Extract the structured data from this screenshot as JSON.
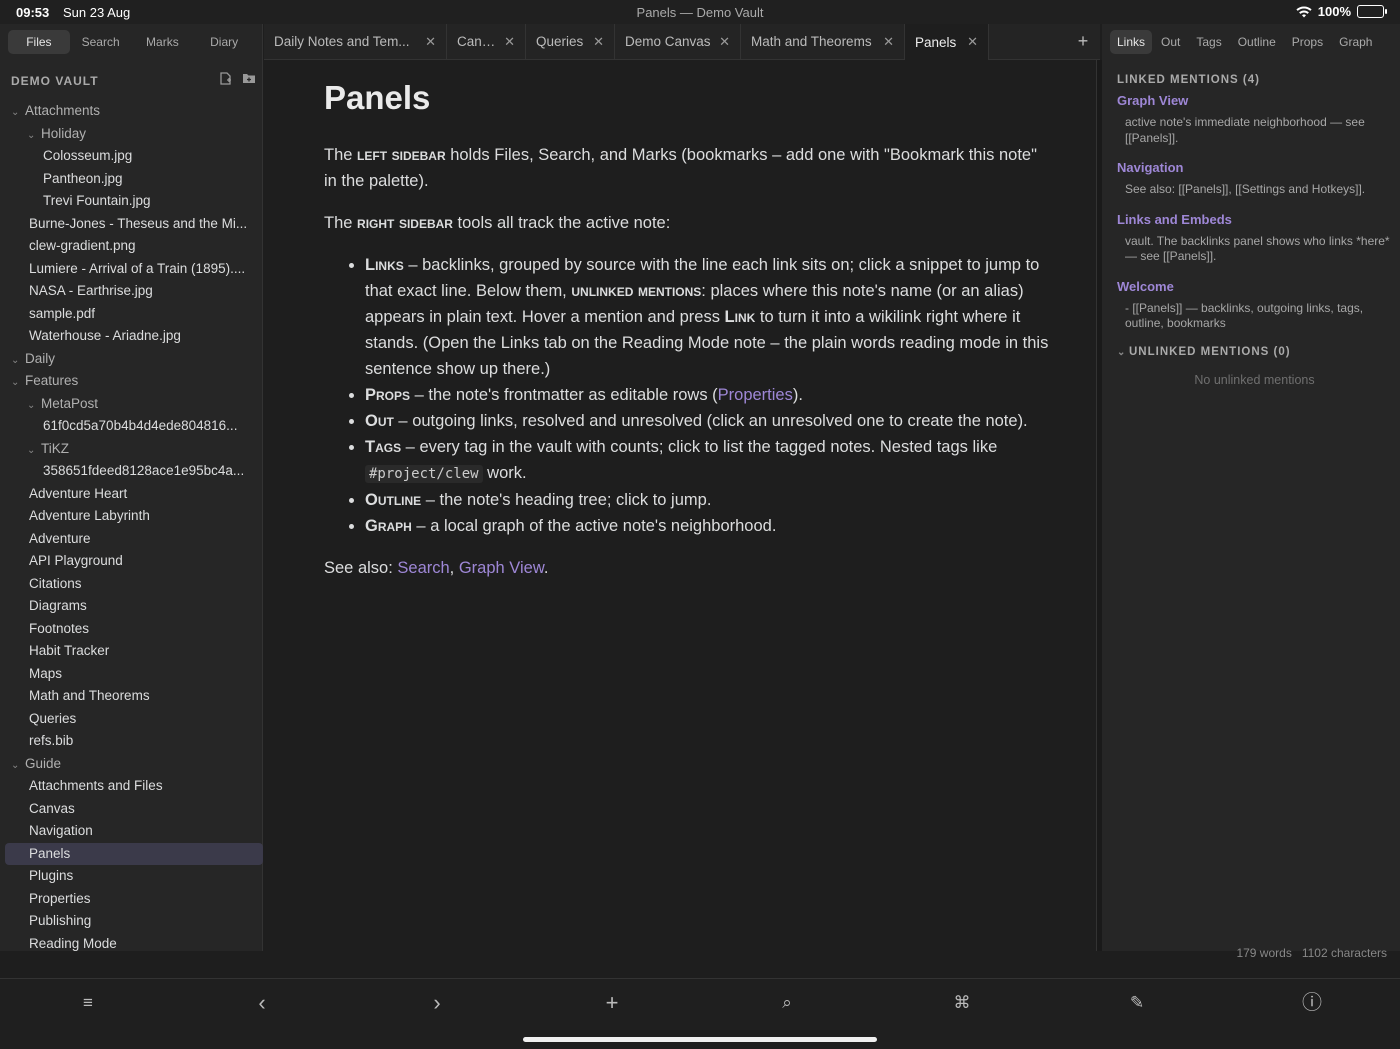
{
  "status": {
    "time": "09:53",
    "date": "Sun 23 Aug",
    "window_title": "Panels — Demo Vault",
    "battery": "100%",
    "battery_level": 1.0
  },
  "left_tabs": [
    {
      "label": "Files",
      "active": true
    },
    {
      "label": "Search",
      "active": false
    },
    {
      "label": "Marks",
      "active": false
    },
    {
      "label": "Diary",
      "active": false
    }
  ],
  "vault": {
    "name": "DEMO VAULT",
    "icon_new_note": "new-note-icon",
    "icon_new_folder": "new-folder-icon"
  },
  "file_tree": [
    {
      "label": "Attachments",
      "folder": true,
      "level": 0
    },
    {
      "label": "Holiday",
      "folder": true,
      "level": 1
    },
    {
      "label": "Colosseum.jpg",
      "level": 2
    },
    {
      "label": "Pantheon.jpg",
      "level": 2
    },
    {
      "label": "Trevi Fountain.jpg",
      "level": 2
    },
    {
      "label": "Burne-Jones - Theseus and the Mi...",
      "level": 1
    },
    {
      "label": "clew-gradient.png",
      "level": 1
    },
    {
      "label": "Lumiere - Arrival of a Train (1895)....",
      "level": 1
    },
    {
      "label": "NASA - Earthrise.jpg",
      "level": 1
    },
    {
      "label": "sample.pdf",
      "level": 1
    },
    {
      "label": "Waterhouse - Ariadne.jpg",
      "level": 1
    },
    {
      "label": "Daily",
      "folder": true,
      "level": 0
    },
    {
      "label": "Features",
      "folder": true,
      "level": 0
    },
    {
      "label": "MetaPost",
      "folder": true,
      "level": 1
    },
    {
      "label": "61f0cd5a70b4b4d4ede804816...",
      "level": 2
    },
    {
      "label": "TiKZ",
      "folder": true,
      "level": 1
    },
    {
      "label": "358651fdeed8128ace1e95bc4a...",
      "level": 2
    },
    {
      "label": "Adventure Heart",
      "level": 1
    },
    {
      "label": "Adventure Labyrinth",
      "level": 1
    },
    {
      "label": "Adventure",
      "level": 1
    },
    {
      "label": "API Playground",
      "level": 1
    },
    {
      "label": "Citations",
      "level": 1
    },
    {
      "label": "Diagrams",
      "level": 1
    },
    {
      "label": "Footnotes",
      "level": 1
    },
    {
      "label": "Habit Tracker",
      "level": 1
    },
    {
      "label": "Maps",
      "level": 1
    },
    {
      "label": "Math and Theorems",
      "level": 1
    },
    {
      "label": "Queries",
      "level": 1
    },
    {
      "label": "refs.bib",
      "level": 1
    },
    {
      "label": "Guide",
      "folder": true,
      "level": 0
    },
    {
      "label": "Attachments and Files",
      "level": 1
    },
    {
      "label": "Canvas",
      "level": 1
    },
    {
      "label": "Navigation",
      "level": 1
    },
    {
      "label": "Panels",
      "level": 1,
      "active": true
    },
    {
      "label": "Plugins",
      "level": 1
    },
    {
      "label": "Properties",
      "level": 1
    },
    {
      "label": "Publishing",
      "level": 1
    },
    {
      "label": "Reading Mode",
      "level": 1
    }
  ],
  "doc_tabs": [
    {
      "label": "Daily Notes and Tem...",
      "active": false
    },
    {
      "label": "Canvas",
      "active": false
    },
    {
      "label": "Queries",
      "active": false
    },
    {
      "label": "Demo Canvas",
      "active": false
    },
    {
      "label": "Math and Theorems",
      "active": false
    },
    {
      "label": "Panels",
      "active": true
    }
  ],
  "note": {
    "title": "Panels",
    "p1": {
      "a": "The ",
      "b": "left sidebar",
      "c": " holds Files, Search, and Marks (bookmarks – add one with \"Bookmark this note\" in the palette)."
    },
    "p2": {
      "a": "The ",
      "b": "right sidebar",
      "c": " tools all track the active note:"
    },
    "links_item": {
      "b1": "Links",
      "t1": " – backlinks, grouped by source with the line each link sits on; click a snippet to jump to that exact line. Below them, ",
      "b2": "unlinked mentions",
      "t2": ": places where this note's name (or an alias) appears in plain text. Hover a mention and press ",
      "b3": "Link",
      "t3": " to turn it into a wikilink right where it stands. (Open the Links tab on the Reading Mode note – the plain words reading mode in this sentence show up there.)"
    },
    "props_item": {
      "b": "Props",
      "t1": " – the note's frontmatter as editable rows (",
      "link": "Properties",
      "t2": ")."
    },
    "out_item": {
      "b": "Out",
      "t": " – outgoing links, resolved and unresolved (click an unresolved one to create the note)."
    },
    "tags_item": {
      "b": "Tags",
      "t1": " – every tag in the vault with counts; click to list the tagged notes. Nested tags like ",
      "code": "#project/clew",
      "t2": " work."
    },
    "outline_item": {
      "b": "Outline",
      "t": " – the note's heading tree; click to jump."
    },
    "graph_item": {
      "b": "Graph",
      "t": " – a local graph of the active note's neighborhood."
    },
    "see_also": {
      "prefix": "See also: ",
      "link1": "Search",
      "sep": ", ",
      "link2": "Graph View",
      "end": "."
    }
  },
  "right_tabs": [
    {
      "label": "Links",
      "active": true
    },
    {
      "label": "Out",
      "active": false
    },
    {
      "label": "Tags",
      "active": false
    },
    {
      "label": "Outline",
      "active": false
    },
    {
      "label": "Props",
      "active": false
    },
    {
      "label": "Graph",
      "active": false
    }
  ],
  "linked_mentions": {
    "heading": "LINKED MENTIONS (4)",
    "groups": [
      {
        "title": "Graph View",
        "snippet": "active note's immediate neighborhood — see [[Panels]]."
      },
      {
        "title": "Navigation",
        "snippet": "See also: [[Panels]], [[Settings and Hotkeys]]."
      },
      {
        "title": "Links and Embeds",
        "snippet": "vault. The backlinks panel shows who links *here* — see [[Panels]]."
      },
      {
        "title": "Welcome",
        "snippet": "- [[Panels]] — backlinks, outgoing links, tags, outline, bookmarks"
      }
    ]
  },
  "unlinked_mentions": {
    "heading": "UNLINKED MENTIONS (0)",
    "empty": "No unlinked mentions"
  },
  "counts": {
    "words": "179 words",
    "chars": "1102 characters"
  },
  "toolbar": {
    "menu": "≡",
    "back": "‹",
    "forward": "›",
    "new": "+",
    "search": "⌕",
    "command": "⌘",
    "edit": "✎",
    "info": "ⓘ"
  },
  "colors": {
    "accent": "#9e87d6",
    "background": "#1e1e1e",
    "sidebar": "#262626",
    "active_row": "#3b3a4a"
  }
}
